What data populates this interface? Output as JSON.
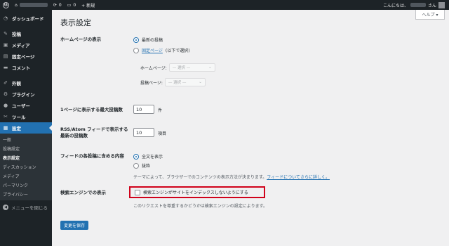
{
  "adminbar": {
    "comments_count": "0",
    "updates_count": "0",
    "new_label": "+ 新規",
    "greeting": "こんにちは、",
    "greeting_suffix": "さん"
  },
  "sidebar": {
    "items": [
      {
        "label": "ダッシュボード",
        "icon": "dashboard-icon",
        "glyph": "◔"
      },
      {
        "label": "投稿",
        "icon": "pin-icon",
        "glyph": "✎"
      },
      {
        "label": "メディア",
        "icon": "media-icon",
        "glyph": "▣"
      },
      {
        "label": "固定ページ",
        "icon": "page-icon",
        "glyph": "▤"
      },
      {
        "label": "コメント",
        "icon": "comment-icon",
        "glyph": "▬"
      },
      {
        "label": "外観",
        "icon": "brush-icon",
        "glyph": "✐"
      },
      {
        "label": "プラグイン",
        "icon": "plugin-icon",
        "glyph": "⚙"
      },
      {
        "label": "ユーザー",
        "icon": "user-icon",
        "glyph": "●"
      },
      {
        "label": "ツール",
        "icon": "wrench-icon",
        "glyph": "✂"
      },
      {
        "label": "設定",
        "icon": "settings-icon",
        "glyph": "▦"
      }
    ],
    "submenu": [
      "一般",
      "投稿設定",
      "表示設定",
      "ディスカッション",
      "メディア",
      "パーマリンク",
      "プライバシー"
    ],
    "collapse_label": "メニューを閉じる"
  },
  "help_tab": "ヘルプ ▾",
  "page": {
    "title": "表示設定",
    "homepage": {
      "label": "ホームページの表示",
      "option_latest": "最新の投稿",
      "option_static_link": "固定ページ",
      "option_static_rest": "(以下で選択)",
      "homepage_label": "ホームページ:",
      "posts_label": "投稿ページ:",
      "select_placeholder": "— 選択 —"
    },
    "posts_per_page": {
      "label": "1ページに表示する最大投稿数",
      "value": "10",
      "unit": "件"
    },
    "rss_items": {
      "label_line1": "RSS/Atom フィードで表示する",
      "label_line2": "最新の投稿数",
      "value": "10",
      "unit": "項目"
    },
    "feed_content": {
      "label": "フィードの各投稿に含める内容",
      "option_full": "全文を表示",
      "option_excerpt": "抜粋",
      "desc": "テーマによって、ブラウザーでのコンテンツの表示方法が決まります。",
      "desc_link": "フィードについてさらに詳しく。"
    },
    "search_visibility": {
      "label": "検索エンジンでの表示",
      "checkbox_label": "検索エンジンがサイトをインデックスしないようにする",
      "desc": "このリクエストを尊重するかどうかは検索エンジンの設定によります。"
    },
    "save_button": "変更を保存"
  },
  "colors": {
    "accent": "#2271b1",
    "highlight": "#d0021b",
    "sidebar": "#1d2327"
  }
}
